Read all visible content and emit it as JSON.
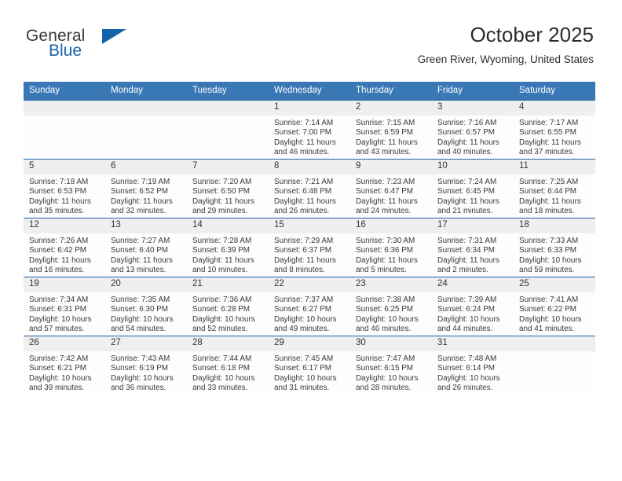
{
  "brand": {
    "name_part1": "General",
    "name_part2": "Blue",
    "accent_color": "#1464aa",
    "triangle_icon": "brand-triangle-icon"
  },
  "header": {
    "month_title": "October 2025",
    "location": "Green River, Wyoming, United States"
  },
  "calendar": {
    "header_bg": "#3a78b5",
    "row_border_color": "#1f63a8",
    "daynum_band_bg": "#efefef",
    "weekday_headers": [
      "Sunday",
      "Monday",
      "Tuesday",
      "Wednesday",
      "Thursday",
      "Friday",
      "Saturday"
    ],
    "labels": {
      "sunrise": "Sunrise:",
      "sunset": "Sunset:",
      "daylight": "Daylight:"
    },
    "weeks": [
      [
        {
          "day": "",
          "empty": true
        },
        {
          "day": "",
          "empty": true
        },
        {
          "day": "",
          "empty": true
        },
        {
          "day": "1",
          "sunrise": "Sunrise: 7:14 AM",
          "sunset": "Sunset: 7:00 PM",
          "daylight": "Daylight: 11 hours and 46 minutes."
        },
        {
          "day": "2",
          "sunrise": "Sunrise: 7:15 AM",
          "sunset": "Sunset: 6:59 PM",
          "daylight": "Daylight: 11 hours and 43 minutes."
        },
        {
          "day": "3",
          "sunrise": "Sunrise: 7:16 AM",
          "sunset": "Sunset: 6:57 PM",
          "daylight": "Daylight: 11 hours and 40 minutes."
        },
        {
          "day": "4",
          "sunrise": "Sunrise: 7:17 AM",
          "sunset": "Sunset: 6:55 PM",
          "daylight": "Daylight: 11 hours and 37 minutes."
        }
      ],
      [
        {
          "day": "5",
          "sunrise": "Sunrise: 7:18 AM",
          "sunset": "Sunset: 6:53 PM",
          "daylight": "Daylight: 11 hours and 35 minutes."
        },
        {
          "day": "6",
          "sunrise": "Sunrise: 7:19 AM",
          "sunset": "Sunset: 6:52 PM",
          "daylight": "Daylight: 11 hours and 32 minutes."
        },
        {
          "day": "7",
          "sunrise": "Sunrise: 7:20 AM",
          "sunset": "Sunset: 6:50 PM",
          "daylight": "Daylight: 11 hours and 29 minutes."
        },
        {
          "day": "8",
          "sunrise": "Sunrise: 7:21 AM",
          "sunset": "Sunset: 6:48 PM",
          "daylight": "Daylight: 11 hours and 26 minutes."
        },
        {
          "day": "9",
          "sunrise": "Sunrise: 7:23 AM",
          "sunset": "Sunset: 6:47 PM",
          "daylight": "Daylight: 11 hours and 24 minutes."
        },
        {
          "day": "10",
          "sunrise": "Sunrise: 7:24 AM",
          "sunset": "Sunset: 6:45 PM",
          "daylight": "Daylight: 11 hours and 21 minutes."
        },
        {
          "day": "11",
          "sunrise": "Sunrise: 7:25 AM",
          "sunset": "Sunset: 6:44 PM",
          "daylight": "Daylight: 11 hours and 18 minutes."
        }
      ],
      [
        {
          "day": "12",
          "sunrise": "Sunrise: 7:26 AM",
          "sunset": "Sunset: 6:42 PM",
          "daylight": "Daylight: 11 hours and 16 minutes."
        },
        {
          "day": "13",
          "sunrise": "Sunrise: 7:27 AM",
          "sunset": "Sunset: 6:40 PM",
          "daylight": "Daylight: 11 hours and 13 minutes."
        },
        {
          "day": "14",
          "sunrise": "Sunrise: 7:28 AM",
          "sunset": "Sunset: 6:39 PM",
          "daylight": "Daylight: 11 hours and 10 minutes."
        },
        {
          "day": "15",
          "sunrise": "Sunrise: 7:29 AM",
          "sunset": "Sunset: 6:37 PM",
          "daylight": "Daylight: 11 hours and 8 minutes."
        },
        {
          "day": "16",
          "sunrise": "Sunrise: 7:30 AM",
          "sunset": "Sunset: 6:36 PM",
          "daylight": "Daylight: 11 hours and 5 minutes."
        },
        {
          "day": "17",
          "sunrise": "Sunrise: 7:31 AM",
          "sunset": "Sunset: 6:34 PM",
          "daylight": "Daylight: 11 hours and 2 minutes."
        },
        {
          "day": "18",
          "sunrise": "Sunrise: 7:33 AM",
          "sunset": "Sunset: 6:33 PM",
          "daylight": "Daylight: 10 hours and 59 minutes."
        }
      ],
      [
        {
          "day": "19",
          "sunrise": "Sunrise: 7:34 AM",
          "sunset": "Sunset: 6:31 PM",
          "daylight": "Daylight: 10 hours and 57 minutes."
        },
        {
          "day": "20",
          "sunrise": "Sunrise: 7:35 AM",
          "sunset": "Sunset: 6:30 PM",
          "daylight": "Daylight: 10 hours and 54 minutes."
        },
        {
          "day": "21",
          "sunrise": "Sunrise: 7:36 AM",
          "sunset": "Sunset: 6:28 PM",
          "daylight": "Daylight: 10 hours and 52 minutes."
        },
        {
          "day": "22",
          "sunrise": "Sunrise: 7:37 AM",
          "sunset": "Sunset: 6:27 PM",
          "daylight": "Daylight: 10 hours and 49 minutes."
        },
        {
          "day": "23",
          "sunrise": "Sunrise: 7:38 AM",
          "sunset": "Sunset: 6:25 PM",
          "daylight": "Daylight: 10 hours and 46 minutes."
        },
        {
          "day": "24",
          "sunrise": "Sunrise: 7:39 AM",
          "sunset": "Sunset: 6:24 PM",
          "daylight": "Daylight: 10 hours and 44 minutes."
        },
        {
          "day": "25",
          "sunrise": "Sunrise: 7:41 AM",
          "sunset": "Sunset: 6:22 PM",
          "daylight": "Daylight: 10 hours and 41 minutes."
        }
      ],
      [
        {
          "day": "26",
          "sunrise": "Sunrise: 7:42 AM",
          "sunset": "Sunset: 6:21 PM",
          "daylight": "Daylight: 10 hours and 39 minutes."
        },
        {
          "day": "27",
          "sunrise": "Sunrise: 7:43 AM",
          "sunset": "Sunset: 6:19 PM",
          "daylight": "Daylight: 10 hours and 36 minutes."
        },
        {
          "day": "28",
          "sunrise": "Sunrise: 7:44 AM",
          "sunset": "Sunset: 6:18 PM",
          "daylight": "Daylight: 10 hours and 33 minutes."
        },
        {
          "day": "29",
          "sunrise": "Sunrise: 7:45 AM",
          "sunset": "Sunset: 6:17 PM",
          "daylight": "Daylight: 10 hours and 31 minutes."
        },
        {
          "day": "30",
          "sunrise": "Sunrise: 7:47 AM",
          "sunset": "Sunset: 6:15 PM",
          "daylight": "Daylight: 10 hours and 28 minutes."
        },
        {
          "day": "31",
          "sunrise": "Sunrise: 7:48 AM",
          "sunset": "Sunset: 6:14 PM",
          "daylight": "Daylight: 10 hours and 26 minutes."
        },
        {
          "day": "",
          "empty": true
        }
      ]
    ]
  }
}
